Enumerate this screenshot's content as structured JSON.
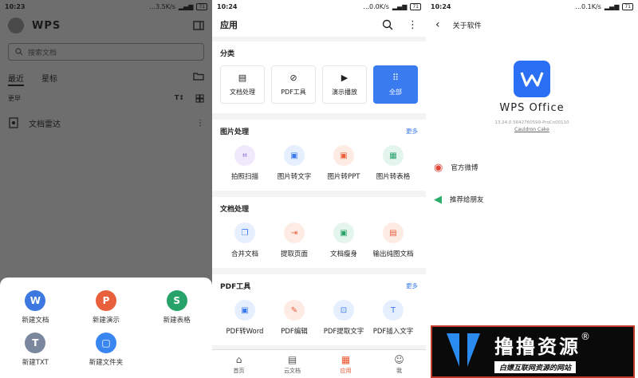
{
  "panel1": {
    "status": {
      "time": "10:23",
      "speed": "...3.5K/s",
      "battery": "71"
    },
    "logo": "WPS",
    "search_placeholder": "搜索文档",
    "tabs": [
      "最近",
      "星标"
    ],
    "sort_label": "更早",
    "doc": "文档雷达",
    "sheet": [
      {
        "label": "新建文档",
        "glyph": "W",
        "color": "#3d78e0"
      },
      {
        "label": "新建演示",
        "glyph": "P",
        "color": "#e8603c"
      },
      {
        "label": "新建表格",
        "glyph": "S",
        "color": "#27a36a"
      },
      {
        "label": "新建TXT",
        "glyph": "T",
        "color": "#7b879c"
      },
      {
        "label": "新建文件夹",
        "glyph": "▢",
        "color": "#3a86f0"
      }
    ]
  },
  "panel2": {
    "status": {
      "time": "10:24",
      "speed": "...0.0K/s",
      "battery": "71"
    },
    "title": "应用",
    "cat_title": "分类",
    "categories": [
      "文档处理",
      "PDF工具",
      "演示播放",
      "全部"
    ],
    "more": "更多",
    "sections": [
      {
        "title": "图片处理",
        "more": true,
        "tools": [
          "拍照扫描",
          "图片转文字",
          "图片转PPT",
          "图片转表格"
        ]
      },
      {
        "title": "文档处理",
        "more": false,
        "tools": [
          "合并文档",
          "提取页面",
          "文档瘦身",
          "输出纯图文档"
        ]
      },
      {
        "title": "PDF工具",
        "more": true,
        "tools": [
          "PDF转Word",
          "PDF编辑",
          "PDF提取文字",
          "PDF插入文字"
        ]
      }
    ],
    "tabbar": [
      "首页",
      "云文档",
      "应用",
      "我"
    ]
  },
  "panel3": {
    "status": {
      "time": "10:24",
      "speed": "...0.1K/s",
      "battery": "71"
    },
    "title": "关于软件",
    "app_name": "WPS Office",
    "version": "13.24.0.5642760599-ProCn00110",
    "cake": "Cauldron Cake",
    "rows": [
      "官方微博",
      "推荐给朋友"
    ]
  },
  "ad": {
    "title": "撸撸资源",
    "reg": "®",
    "subtitle": "白嫖互联网资源的网站"
  }
}
